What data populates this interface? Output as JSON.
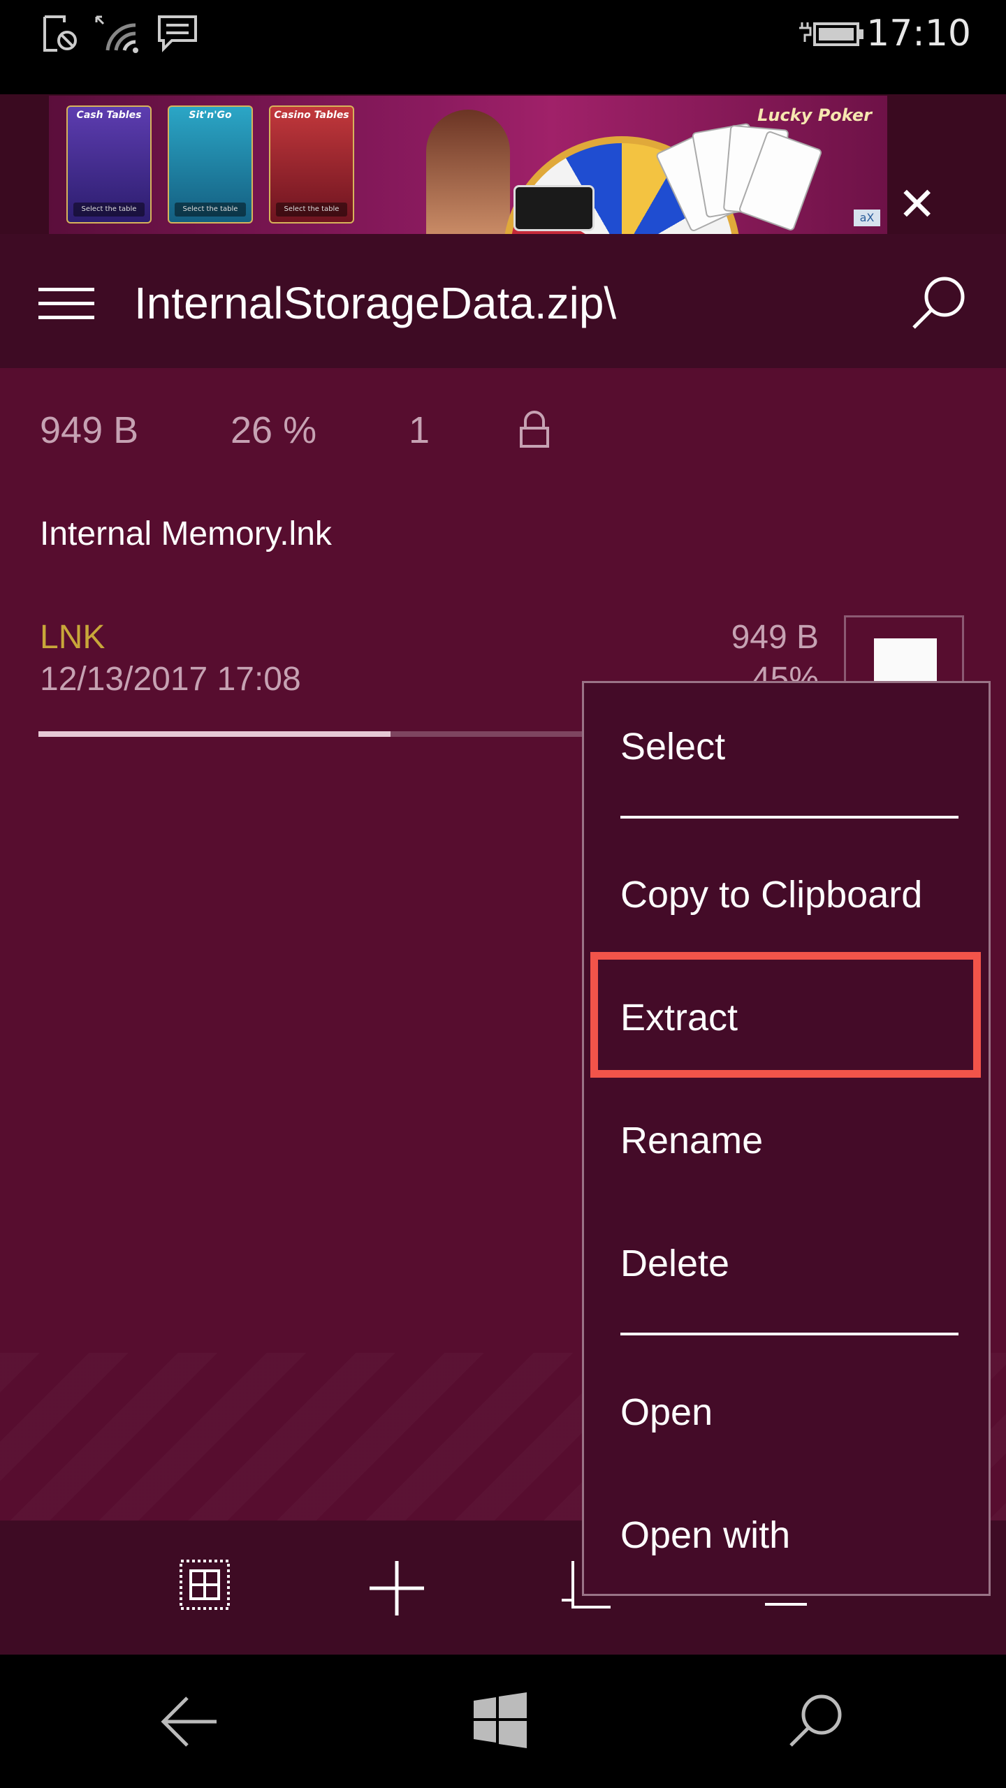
{
  "status_bar": {
    "time": "17:10",
    "icons": [
      "data-saver-icon",
      "wifi-icon",
      "message-icon",
      "battery-charging-icon"
    ]
  },
  "ad": {
    "cards": [
      "Cash Tables",
      "Sit'n'Go",
      "Casino Tables"
    ],
    "card_button": "Select the table",
    "brand": "Lucky Poker",
    "badge": "aX",
    "close": "✕"
  },
  "app_bar": {
    "title": "InternalStorageData.zip\\",
    "menu_icon": "hamburger-icon",
    "search_icon": "search-icon"
  },
  "archive_info": {
    "size": "949 B",
    "compression": "26 %",
    "count": "1",
    "lock_icon": "lock-icon"
  },
  "entry": {
    "name": "Internal Memory.lnk",
    "type": "LNK",
    "date": "12/13/2017 17:08",
    "size": "949 B",
    "ratio": "45%",
    "progress": 0.45
  },
  "context_menu": {
    "items": [
      {
        "label": "Select"
      },
      {
        "label": "Copy to Clipboard"
      },
      {
        "label": "Extract",
        "highlighted": true
      },
      {
        "label": "Rename"
      },
      {
        "label": "Delete"
      },
      {
        "label": "Open"
      },
      {
        "label": "Open with"
      }
    ]
  },
  "bottom_bar": {
    "buttons": [
      "select-all-icon",
      "add-icon",
      "copy-icon",
      "more-icon"
    ]
  },
  "nav_bar": {
    "buttons": [
      "back-icon",
      "windows-icon",
      "search-icon"
    ]
  },
  "colors": {
    "accent": "#570d2f",
    "appbar": "#3e0b24",
    "type_label": "#c8a73a",
    "highlight": "#f2544a"
  }
}
